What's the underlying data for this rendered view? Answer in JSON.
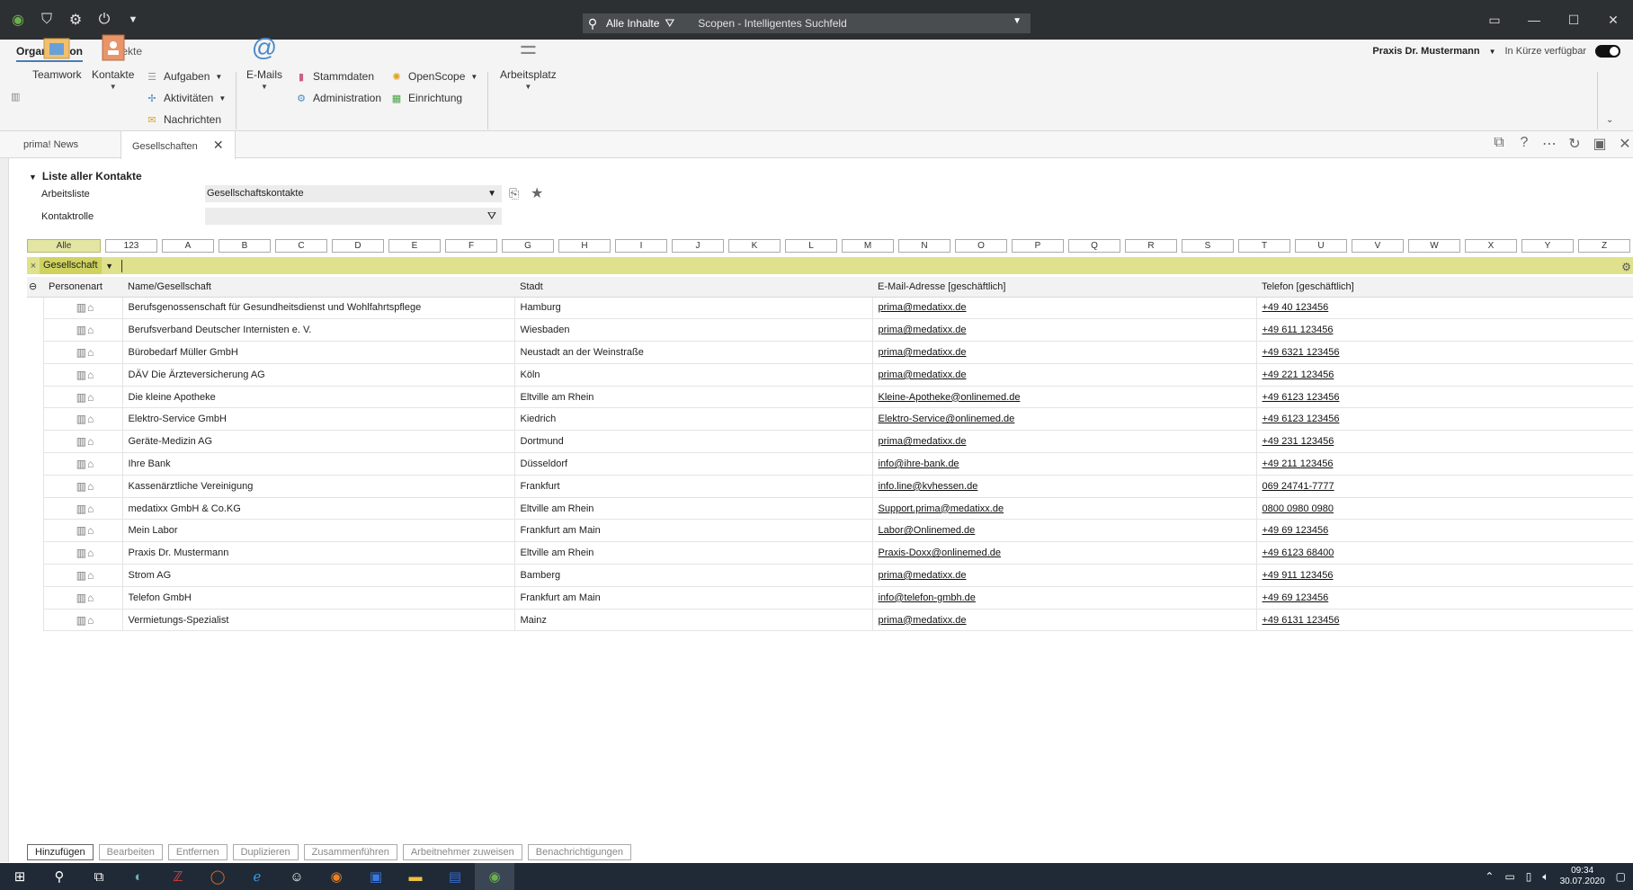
{
  "search": {
    "scope": "Alle Inhalte",
    "text": "Scopen - Intelligentes Suchfeld"
  },
  "ribbon": {
    "tabs": [
      "Organisation",
      "Projekte"
    ],
    "user": "Praxis Dr. Mustermann",
    "status": "In Kürze verfügbar",
    "buttons": {
      "teamwork": "Teamwork",
      "kontakte": "Kontakte",
      "aufgaben": "Aufgaben",
      "aktivitaeten": "Aktivitäten",
      "nachrichten": "Nachrichten",
      "emails": "E-Mails",
      "stammdaten": "Stammdaten",
      "administration": "Administration",
      "openscope": "OpenScope",
      "einrichtung": "Einrichtung",
      "arbeitsplatz": "Arbeitsplatz"
    }
  },
  "doc_tabs": {
    "news": "prima! News",
    "gesellschaften": "Gesellschaften"
  },
  "section": {
    "title": "Liste aller Kontakte",
    "arbeitsliste_label": "Arbeitsliste",
    "arbeitsliste_value": "Gesellschaftskontakte",
    "kontaktrolle_label": "Kontaktrolle",
    "kontaktrolle_value": ""
  },
  "alphabet": [
    "Alle",
    "123",
    "A",
    "B",
    "C",
    "D",
    "E",
    "F",
    "G",
    "H",
    "I",
    "J",
    "K",
    "L",
    "M",
    "N",
    "O",
    "P",
    "Q",
    "R",
    "S",
    "T",
    "U",
    "V",
    "W",
    "X",
    "Y",
    "Z"
  ],
  "filter": {
    "tag": "Gesellschaft"
  },
  "table": {
    "headers": [
      "Personenart",
      "Name/Gesellschaft",
      "Stadt",
      "E-Mail-Adresse [geschäftlich]",
      "Telefon [geschäftlich]"
    ],
    "rows": [
      {
        "name": "Berufsgenossenschaft für Gesundheitsdienst und Wohlfahrtspflege",
        "city": "Hamburg",
        "email": "prima@medatixx.de",
        "phone": "+49 40 123456"
      },
      {
        "name": "Berufsverband Deutscher Internisten e. V.",
        "city": "Wiesbaden",
        "email": "prima@medatixx.de",
        "phone": "+49 611 123456"
      },
      {
        "name": "Bürobedarf Müller GmbH",
        "city": "Neustadt an der Weinstraße",
        "email": "prima@medatixx.de",
        "phone": "+49 6321 123456"
      },
      {
        "name": "DÄV Die Ärzteversicherung AG",
        "city": "Köln",
        "email": "prima@medatixx.de",
        "phone": "+49 221 123456"
      },
      {
        "name": "Die kleine Apotheke",
        "city": "Eltville am Rhein",
        "email": "Kleine-Apotheke@onlinemed.de",
        "phone": "+49 6123 123456"
      },
      {
        "name": "Elektro-Service GmbH",
        "city": "Kiedrich",
        "email": "Elektro-Service@onlinemed.de",
        "phone": "+49 6123 123456"
      },
      {
        "name": "Geräte-Medizin AG",
        "city": "Dortmund",
        "email": "prima@medatixx.de",
        "phone": "+49 231 123456"
      },
      {
        "name": "Ihre Bank",
        "city": "Düsseldorf",
        "email": "info@ihre-bank.de",
        "phone": "+49 211 123456"
      },
      {
        "name": "Kassenärztliche Vereinigung",
        "city": "Frankfurt",
        "email": "info.line@kvhessen.de",
        "phone": "069 24741-7777"
      },
      {
        "name": "medatixx GmbH & Co.KG",
        "city": "Eltville am Rhein",
        "email": "Support.prima@medatixx.de",
        "phone": "0800 0980 0980"
      },
      {
        "name": "Mein Labor",
        "city": "Frankfurt am Main",
        "email": "Labor@Onlinemed.de",
        "phone": "+49 69 123456"
      },
      {
        "name": "Praxis Dr. Mustermann",
        "city": "Eltville am Rhein",
        "email": "Praxis-Doxx@onlinemed.de",
        "phone": "+49 6123 68400"
      },
      {
        "name": "Strom AG",
        "city": "Bamberg",
        "email": "prima@medatixx.de",
        "phone": "+49 911 123456"
      },
      {
        "name": "Telefon GmbH",
        "city": "Frankfurt am Main",
        "email": "info@telefon-gmbh.de",
        "phone": "+49 69 123456"
      },
      {
        "name": "Vermietungs-Spezialist",
        "city": "Mainz",
        "email": "prima@medatixx.de",
        "phone": "+49 6131 123456"
      }
    ]
  },
  "bottom_buttons": [
    "Hinzufügen",
    "Bearbeiten",
    "Entfernen",
    "Duplizieren",
    "Zusammenführen",
    "Arbeitnehmer zuweisen",
    "Benachrichtigungen"
  ],
  "taskbar": {
    "time": "09:34",
    "date": "30.07.2020"
  }
}
